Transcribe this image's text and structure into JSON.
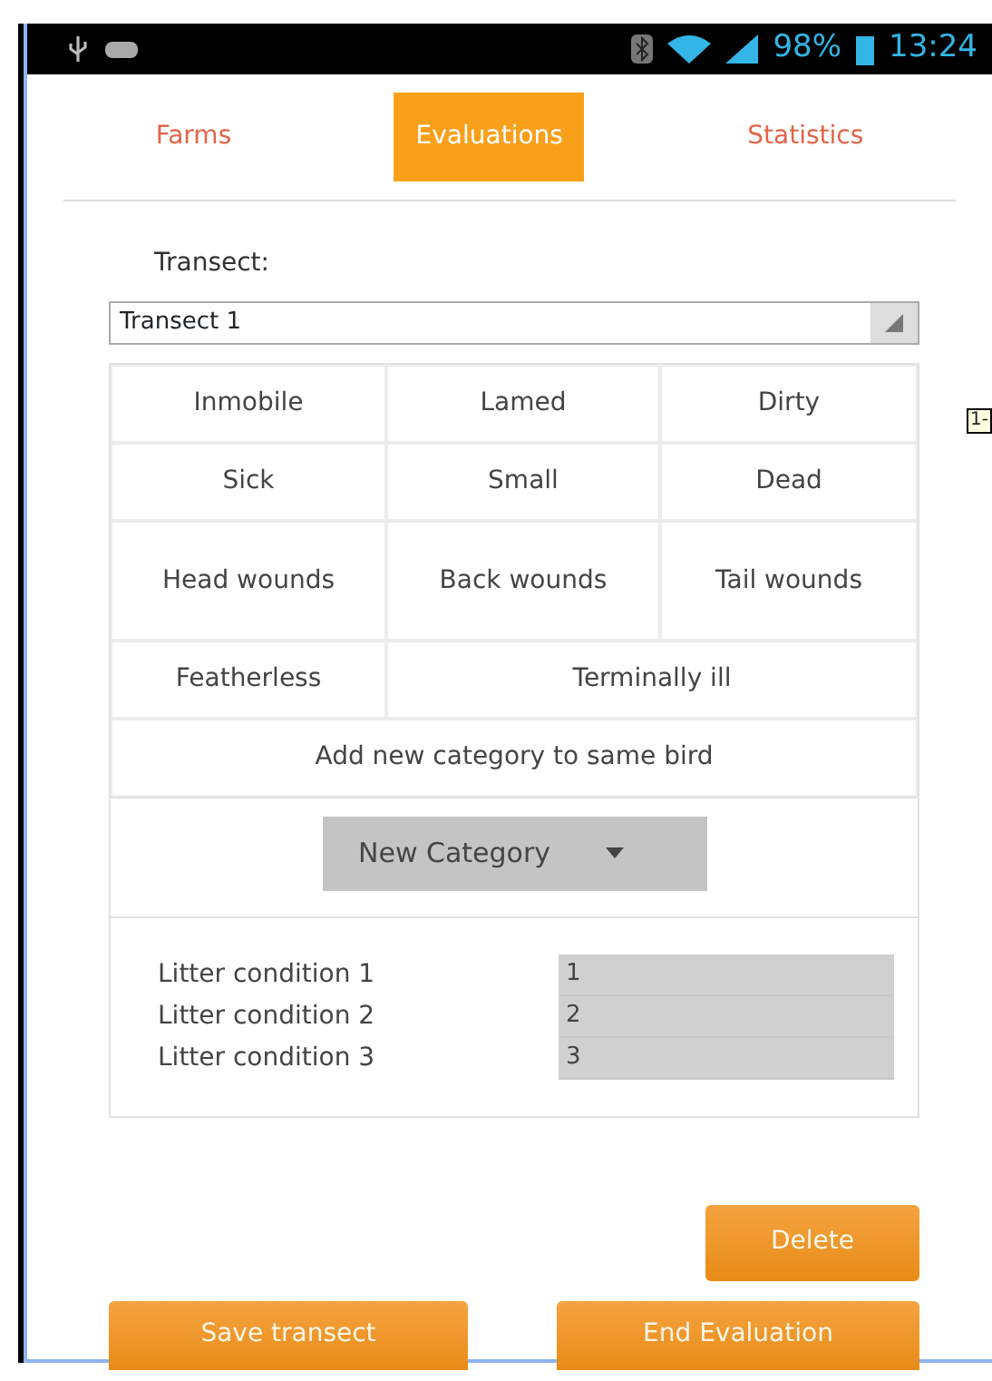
{
  "status_bar": {
    "battery": "98%",
    "time": "13:24"
  },
  "tabs": [
    {
      "label": "Farms",
      "selected": false
    },
    {
      "label": "Evaluations",
      "selected": true
    },
    {
      "label": "Statistics",
      "selected": false
    }
  ],
  "transect": {
    "label": "Transect:",
    "value": "Transect 1"
  },
  "categories": [
    [
      "Inmobile",
      "Lamed",
      "Dirty"
    ],
    [
      "Sick",
      "Small",
      "Dead"
    ],
    [
      "Head wounds",
      "Back wounds",
      "Tail wounds"
    ],
    [
      "Featherless",
      "Terminally ill"
    ],
    [
      "Add new category to same bird"
    ]
  ],
  "new_category": {
    "label": "New Category"
  },
  "litter": [
    {
      "label": "Litter condition 1",
      "value": "1"
    },
    {
      "label": "Litter condition 2",
      "value": "2"
    },
    {
      "label": "Litter condition 3",
      "value": "3"
    }
  ],
  "delete_button": "Delete",
  "bottom_buttons": [
    "Save transect",
    "End Evaluation"
  ],
  "tooltip": "1-"
}
